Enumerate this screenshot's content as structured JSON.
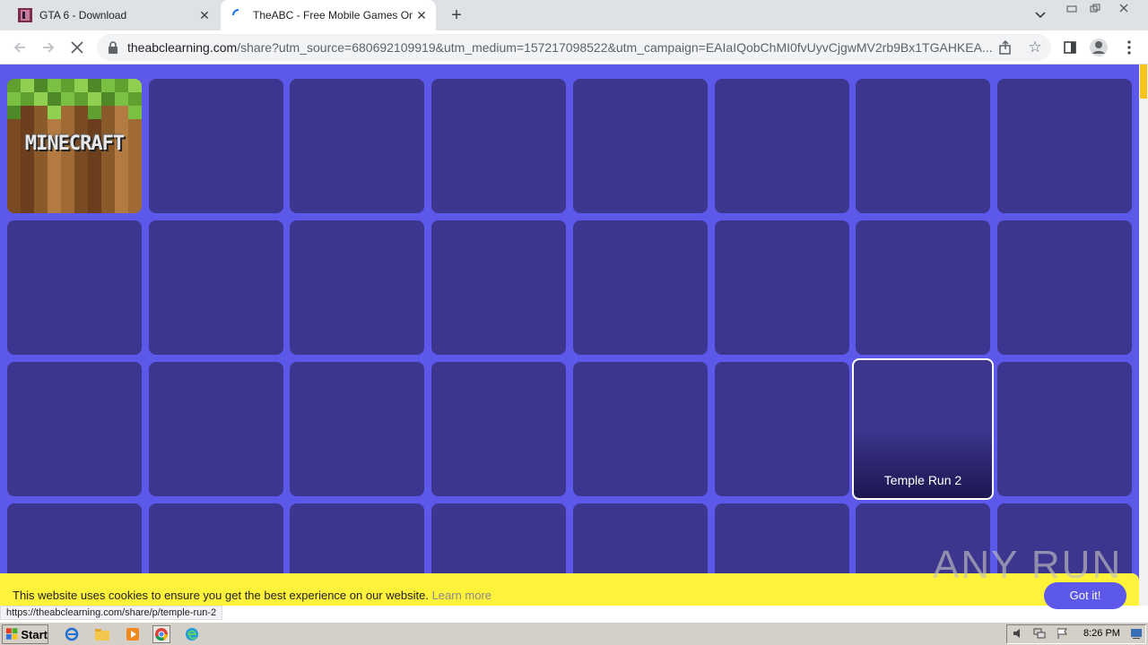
{
  "browser": {
    "tabs": [
      {
        "title": "GTA 6 - Download",
        "active": false,
        "favicon": "game-cover-icon"
      },
      {
        "title": "TheABC - Free Mobile Games Online",
        "active": true,
        "favicon": "loading-spinner-icon"
      }
    ],
    "address": {
      "host": "theabclearning.com",
      "path": "/share?utm_source=680692109919&utm_medium=157217098522&utm_campaign=EAIaIQobChMI0fvUyvCjgwMV2rb9Bx1TGAHKEA..."
    },
    "status_url": "https://theabclearning.com/share/p/temple-run-2"
  },
  "page": {
    "tiles": [
      {
        "label": "MINECRAFT",
        "type": "minecraft"
      },
      {
        "label": ""
      },
      {
        "label": ""
      },
      {
        "label": ""
      },
      {
        "label": ""
      },
      {
        "label": ""
      },
      {
        "label": ""
      },
      {
        "label": ""
      },
      {
        "label": ""
      },
      {
        "label": ""
      },
      {
        "label": ""
      },
      {
        "label": ""
      },
      {
        "label": ""
      },
      {
        "label": ""
      },
      {
        "label": ""
      },
      {
        "label": ""
      },
      {
        "label": ""
      },
      {
        "label": ""
      },
      {
        "label": ""
      },
      {
        "label": ""
      },
      {
        "label": ""
      },
      {
        "label": ""
      },
      {
        "label": "Temple Run 2",
        "type": "highlight"
      },
      {
        "label": ""
      },
      {
        "label": ""
      },
      {
        "label": ""
      },
      {
        "label": ""
      },
      {
        "label": ""
      },
      {
        "label": ""
      },
      {
        "label": ""
      },
      {
        "label": ""
      },
      {
        "label": ""
      }
    ],
    "cookie": {
      "message": "This website uses cookies to ensure you get the best experience on our website.",
      "learn_more": "Learn more",
      "button": "Got it!"
    },
    "colors": {
      "background": "#5b58ea",
      "tile": "#3c368f",
      "banner": "#fff23a"
    }
  },
  "watermark": "ANY RUN",
  "taskbar": {
    "start_label": "Start",
    "quicklaunch": [
      "ie-icon",
      "folder-icon",
      "media-player-icon",
      "chrome-icon",
      "edge-icon"
    ],
    "clock": "8:26 PM"
  }
}
